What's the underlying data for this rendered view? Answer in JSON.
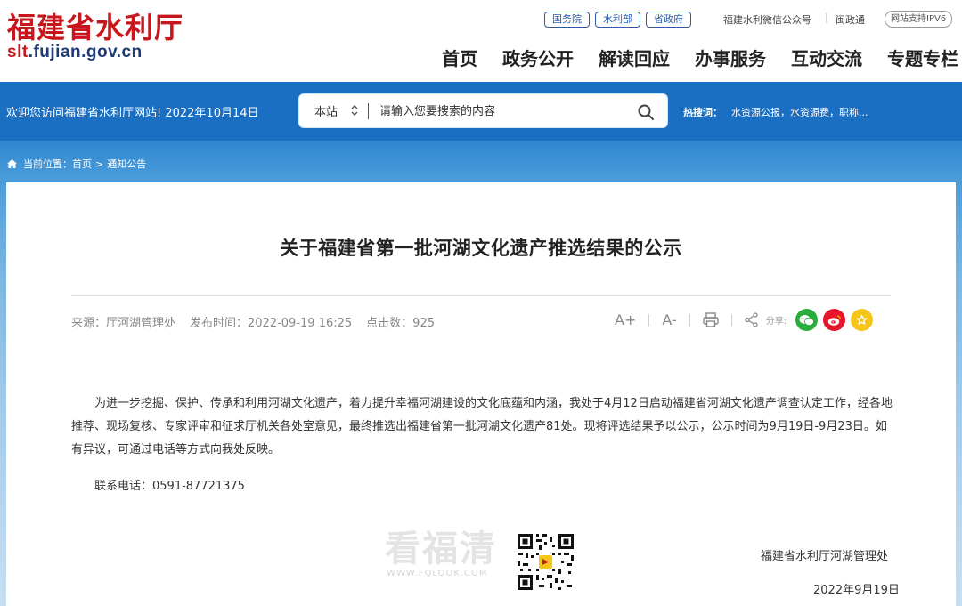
{
  "header": {
    "site_name": "福建省水利厅",
    "site_url_prefix": "slt",
    "site_url_suffix": ".fujian.gov.cn",
    "top_links": [
      "国务院",
      "水利部",
      "省政府"
    ],
    "wechat": "福建水利微信公众号",
    "separator": "|",
    "mzt": "闽政通",
    "ipv6": "网站支持IPV6",
    "nav": [
      "首页",
      "政务公开",
      "解读回应",
      "办事服务",
      "互动交流",
      "专题专栏"
    ]
  },
  "band": {
    "welcome": "欢迎您访问福建省水利厅网站! 2022年10月14日",
    "search_scope": "本站",
    "search_placeholder": "请输入您要搜索的内容",
    "hot_label": "热搜词：",
    "hot_items": "水资源公报，水资源费，职称..."
  },
  "breadcrumb": {
    "label": "当前位置：",
    "home": "首页",
    "sep": ">",
    "section": "通知公告"
  },
  "article": {
    "title": "关于福建省第一批河湖文化遗产推选结果的公示",
    "source": "来源：厅河湖管理处",
    "publish_time": "发布时间：2022-09-19 16:25",
    "clicks": "点击数：925",
    "tools": {
      "font_up": "A+",
      "font_down": "A-",
      "share_label": "分享:"
    },
    "body": "为进一步挖掘、保护、传承和利用河湖文化遗产，着力提升幸福河湖建设的文化底蕴和内涵，我处于4月12日启动福建省河湖文化遗产调查认定工作，经各地推荐、现场复核、专家评审和征求厅机关各处室意见，最终推选出福建省第一批河湖文化遗产81处。现将评选结果予以公示，公示时间为9月19日-9月23日。如有异议，可通过电话等方式向我处反映。",
    "contact": "联系电话：0591-87721375",
    "signature_org": "福建省水利厅河湖管理处",
    "signature_date": "2022年9月19日"
  },
  "watermark": {
    "text": "看福清",
    "url": "WWW.FQLOOK.COM"
  },
  "colors": {
    "brand_red": "#c8161d",
    "brand_blue": "#1a6fc2",
    "wechat_green": "#2aae3b",
    "weibo_red": "#e6162d",
    "qzone_yellow": "#f5c518"
  }
}
